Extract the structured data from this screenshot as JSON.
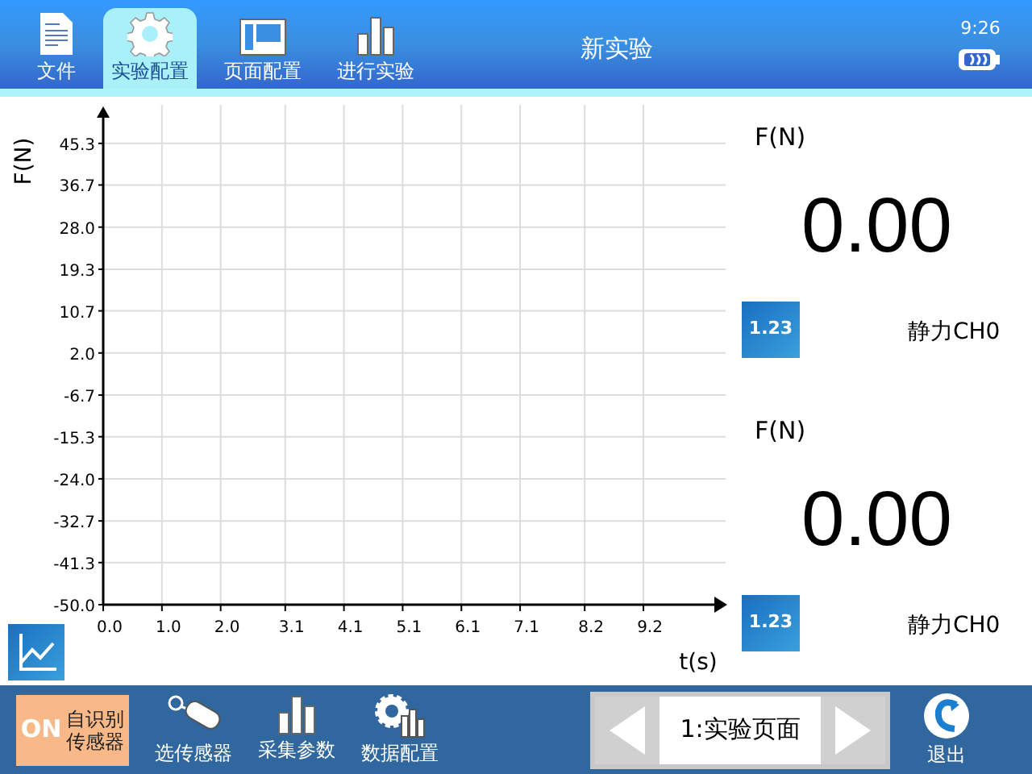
{
  "top_tabs": [
    {
      "label": "文件",
      "selected": false
    },
    {
      "label": "实验配置",
      "selected": true
    },
    {
      "label": "页面配置",
      "selected": false
    },
    {
      "label": "进行实验",
      "selected": false
    }
  ],
  "window": {
    "title": "新实验",
    "time": "9:26"
  },
  "chart": {
    "chart_data": {
      "type": "line",
      "grid": true,
      "xlabel": "t(s)",
      "ylabel": "F(N)",
      "xlim": [
        0,
        10.6
      ],
      "ylim": [
        -50,
        52.6
      ],
      "xticks": [
        {
          "value": 0,
          "label": "0.0"
        },
        {
          "value": 1,
          "label": "1.0"
        },
        {
          "value": 2,
          "label": "2.0"
        },
        {
          "value": 3.1,
          "label": "3.1"
        },
        {
          "value": 4.1,
          "label": "4.1"
        },
        {
          "value": 5.1,
          "label": "5.1"
        },
        {
          "value": 6.1,
          "label": "6.1"
        },
        {
          "value": 7.1,
          "label": "7.1"
        },
        {
          "value": 8.2,
          "label": "8.2"
        },
        {
          "value": 9.2,
          "label": "9.2"
        }
      ],
      "yticks": [
        {
          "value": 45.3,
          "label": "45.3"
        },
        {
          "value": 36.7,
          "label": "36.7"
        },
        {
          "value": 28,
          "label": "28.0"
        },
        {
          "value": 19.3,
          "label": "19.3"
        },
        {
          "value": 10.7,
          "label": "10.7"
        },
        {
          "value": 2,
          "label": "2.0"
        },
        {
          "value": -6.7,
          "label": "-6.7"
        },
        {
          "value": -15.3,
          "label": "-15.3"
        },
        {
          "value": -24,
          "label": "-24.0"
        },
        {
          "value": -32.7,
          "label": "-32.7"
        },
        {
          "value": -41.3,
          "label": "-41.3"
        },
        {
          "value": -50,
          "label": "-50.0"
        }
      ]
    }
  },
  "meters": [
    {
      "unit": "F(N)",
      "value": "0.00",
      "icon_label": "1.23",
      "channel": "静力CH0"
    },
    {
      "unit": "F(N)",
      "value": "0.00",
      "icon_label": "1.23",
      "channel": "静力CH0"
    }
  ],
  "auto_detect": {
    "on": true,
    "badge": "ON",
    "lines": [
      "自识别",
      "传感器"
    ]
  },
  "tools": [
    {
      "label": "选传感器"
    },
    {
      "label": "采集参数"
    },
    {
      "label": "数据配置"
    }
  ],
  "page_nav": {
    "page": "1:实验页面"
  },
  "exit": {
    "label": "退出"
  }
}
